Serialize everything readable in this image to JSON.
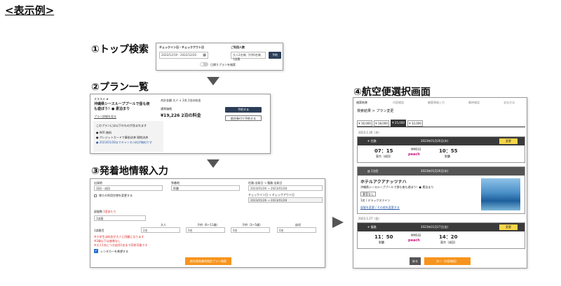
{
  "page_heading": "<表示例>",
  "sections": {
    "top_search": "①トップ検索",
    "plan_list": "②プラン一覧",
    "departure_info": "③発着地情報入力",
    "flight_select": "④航空便選択画面"
  },
  "top_search_panel": {
    "checkin_label": "チェックイン日・チェックアウト日",
    "guests_label": "ご利用人数",
    "dates_value": "2022/12/19 - 2022/12/20",
    "guests_value": "大人2名様, 子供0名様, 1部屋",
    "search_button": "予約",
    "day_trip_toggle": "日帰りプランを検索"
  },
  "plan_list_panel": {
    "recommend": "オススメ ★",
    "plan_title": "沖縄県シースループプールで昼も夜も遊ぼう！● 素泊まり",
    "plan_detail_link": "プラン詳細を見る",
    "summary": "合計金額 大人 × 2名 2泊の料金",
    "price_label": "通常価格",
    "price": "¥19,226 2泊の料金",
    "includes_title": "このプランには以下のものが含まれます",
    "includes_items": [
      "● WiFi 無料",
      "● クレジットカードで事前決済 現地決済",
      "● 2023/01/28までキャンセル料が無料です"
    ],
    "reserve_button": "予約する",
    "compare_button": "航空券付で予約する"
  },
  "departure_panel": {
    "departure_label": "出発地",
    "departure_value": "羽田・成田",
    "arrival_label": "到着地",
    "arrival_value": "那覇",
    "return_checkbox": "帰りの利用空港を変更する",
    "date_label": "往路 出発日 → 復路 出発日",
    "date_value": "2023/01/26 → 2023/01/28",
    "checkin_label": "チェックイン日 → チェックアウト日",
    "checkin_value": "2023/01/26 → 2023/01/28",
    "rooms_label": "部屋数",
    "rooms_note": "1室あたり",
    "rooms_value": "1部屋",
    "per_room_label": "1部屋目",
    "adult_label": "大人",
    "adult_value": "2名",
    "child1_label": "子供（6〜11歳）",
    "child1_value": "0名",
    "child2_label": "子供（3〜5歳）",
    "child2_value": "0名",
    "infant_label": "幼児",
    "infant_value": "0名",
    "notes": [
      "※小学生は料金が大人と同額になります",
      "※2歳以下は座席なし",
      "※大人1名につき幼児1名まで同伴可能です"
    ],
    "rental_car": "レンタカーを希望する",
    "search_button": "航空便発着地指定プラン検索"
  },
  "flight_panel": {
    "steps": [
      "検索結果",
      "内容確認",
      "顧客情報入力",
      "最終確認",
      "支払方法"
    ],
    "title": "検索結果 > プラン変更",
    "fare_tabs": [
      "¥ 16,000",
      "¥ 18,000",
      "¥ 25,000",
      "¥ 32,000"
    ],
    "day1": "2023.1.26（木）",
    "outbound_tag": "往路",
    "outbound_date": "2023年01月26日(木)",
    "change_button": "変更",
    "outbound_dep_time": "07：15",
    "outbound_dep_place": "東京（成田）",
    "outbound_flight": "MM501",
    "outbound_airline": "peach",
    "outbound_arr_time": "10：55",
    "outbound_arr_place": "那覇",
    "hotel_tag": "1泊目",
    "hotel_date": "2023年01月26日(木)",
    "hotel_name": "ホテルアクアナッツナハ",
    "hotel_plan": "沖縄県シースループプールで昼も夜も遊ぼう！● 素泊まり",
    "hotel_badge": "客室なし",
    "hotel_room": "1名 / デラックスツイン",
    "hotel_link": "部屋を変更 / その他を変更する",
    "day2": "2023.1.27（金）",
    "return_tag": "復路",
    "return_date": "2023年01月27日(金)",
    "return_change_button": "変更（内容確認）",
    "return_dep_time": "11：50",
    "return_dep_place": "那覇",
    "return_flight": "MM502",
    "return_airline": "peach",
    "return_arr_time": "14：20",
    "return_arr_place": "東京（成田）",
    "back_button": "戻る",
    "next_button": "次へ（内容確認）"
  },
  "colors": {
    "dark_header": "#3a3a3a",
    "accent_orange": "#f7941d",
    "peach_pink": "#c8127c",
    "navy_button": "#2c3e57",
    "change_yellow": "#f5d54a"
  }
}
